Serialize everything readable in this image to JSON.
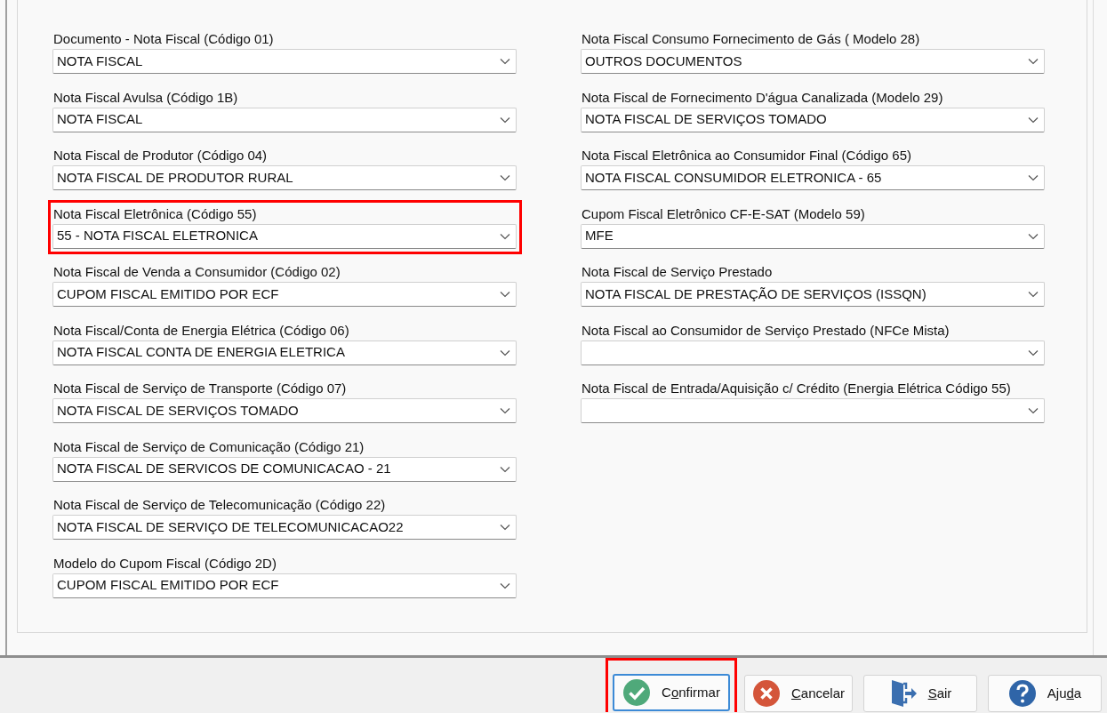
{
  "columns": [
    {
      "fields": [
        {
          "label": "Documento - Nota Fiscal (Código 01)",
          "value": "NOTA FISCAL",
          "highlighted": false
        },
        {
          "label": "Nota Fiscal Avulsa (Código 1B)",
          "value": "NOTA FISCAL",
          "highlighted": false
        },
        {
          "label": "Nota Fiscal de Produtor (Código 04)",
          "value": "NOTA FISCAL DE PRODUTOR RURAL",
          "highlighted": false
        },
        {
          "label": "Nota Fiscal Eletrônica (Código 55)",
          "value": "55 - NOTA FISCAL ELETRONICA",
          "highlighted": true
        },
        {
          "label": "Nota Fiscal de Venda a Consumidor (Código 02)",
          "value": "CUPOM FISCAL EMITIDO POR ECF",
          "highlighted": false
        },
        {
          "label": "Nota Fiscal/Conta de Energia Elétrica (Código 06)",
          "value": "NOTA FISCAL CONTA DE ENERGIA ELETRICA",
          "highlighted": false
        },
        {
          "label": "Nota Fiscal de Serviço de Transporte (Código 07)",
          "value": "NOTA FISCAL DE SERVIÇOS TOMADO",
          "highlighted": false
        },
        {
          "label": "Nota Fiscal de Serviço de Comunicação (Código 21)",
          "value": "NOTA FISCAL DE SERVICOS DE COMUNICACAO - 21",
          "highlighted": false
        },
        {
          "label": "Nota Fiscal de Serviço de Telecomunicação (Código 22)",
          "value": "NOTA FISCAL DE SERVIÇO DE TELECOMUNICACAO22",
          "highlighted": false
        },
        {
          "label": "Modelo do Cupom Fiscal (Código 2D)",
          "value": "CUPOM FISCAL EMITIDO POR ECF",
          "highlighted": false
        }
      ]
    },
    {
      "fields": [
        {
          "label": "Nota Fiscal Consumo Fornecimento de Gás ( Modelo 28)",
          "value": "OUTROS DOCUMENTOS",
          "highlighted": false
        },
        {
          "label": "Nota Fiscal de Fornecimento D'água Canalizada (Modelo 29)",
          "value": "NOTA FISCAL DE SERVIÇOS TOMADO",
          "highlighted": false
        },
        {
          "label": "Nota Fiscal Eletrônica ao Consumidor Final (Código 65)",
          "value": "NOTA FISCAL CONSUMIDOR ELETRONICA - 65",
          "highlighted": false
        },
        {
          "label": "Cupom Fiscal Eletrônico CF-E-SAT (Modelo 59)",
          "value": "MFE",
          "highlighted": false
        },
        {
          "label": "Nota Fiscal de Serviço Prestado",
          "value": "NOTA FISCAL DE PRESTAÇÃO DE SERVIÇOS (ISSQN)",
          "highlighted": false
        },
        {
          "label": "Nota Fiscal ao Consumidor de Serviço Prestado (NFCe Mista)",
          "highlighted": false
        },
        {
          "label": "Nota Fiscal de Entrada/Aquisição c/ Crédito (Energia Elétrica Código 55)",
          "highlighted": false
        }
      ]
    }
  ],
  "buttons": [
    {
      "kind": "confirm",
      "label_parts": [
        {
          "text": "C",
          "underlined": false
        },
        {
          "text": "o",
          "underlined": true
        },
        {
          "text": "nfirmar",
          "underlined": false
        }
      ],
      "focused": true,
      "highlighted": true
    },
    {
      "kind": "cancel",
      "label_parts": [
        {
          "text": "C",
          "underlined": true
        },
        {
          "text": "ancelar",
          "underlined": false
        }
      ],
      "focused": false,
      "highlighted": false
    },
    {
      "kind": "exit",
      "label_parts": [
        {
          "text": "S",
          "underlined": true
        },
        {
          "text": "air",
          "underlined": false
        }
      ],
      "focused": false,
      "highlighted": false
    },
    {
      "kind": "help",
      "label_parts": [
        {
          "text": "Aju",
          "underlined": false
        },
        {
          "text": "d",
          "underlined": true
        },
        {
          "text": "a",
          "underlined": false
        }
      ],
      "focused": false,
      "highlighted": false
    }
  ]
}
